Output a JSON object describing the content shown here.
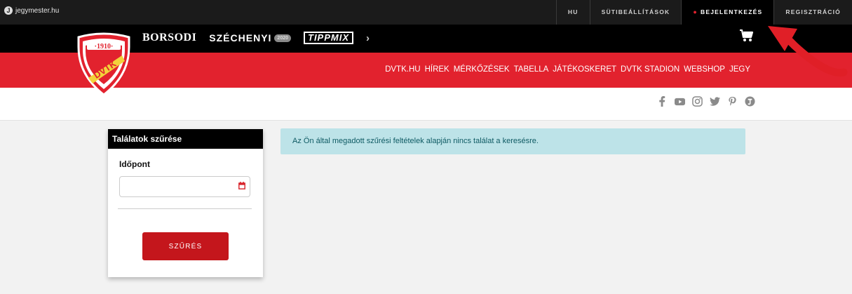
{
  "topbar": {
    "brand": "jegymester.hu",
    "links": {
      "lang": "HU",
      "cookies": "SÜTIBEÁLLÍTÁSOK",
      "login": "BEJELENTKEZÉS",
      "register": "REGISZTRÁCIÓ"
    }
  },
  "sponsors": {
    "borsodi": "BORSODI",
    "szechenyi": "SZÉCHENYI",
    "szechenyi_badge": "2020",
    "tippmix": "TIPPMIX",
    "next": "›"
  },
  "logo": {
    "year": "·1910·",
    "text": "DVTK"
  },
  "nav": {
    "items": [
      "DVTK.HU",
      "HÍREK",
      "MÉRKŐZÉSEK",
      "TABELLA",
      "JÁTÉKOSKERET",
      "DVTK STADION",
      "WEBSHOP",
      "JEGY"
    ]
  },
  "social": [
    "facebook-icon",
    "youtube-icon",
    "instagram-icon",
    "twitter-icon",
    "pinterest-icon",
    "jegymester-icon"
  ],
  "filter": {
    "title": "Találatok szűrése",
    "date_label": "Időpont",
    "date_value": "",
    "button": "SZŰRÉS"
  },
  "alert": {
    "message": "Az Ön által megadott szűrési feltételek alapján nincs találat a keresésre."
  },
  "colors": {
    "red": "#e2222e",
    "black": "#000000",
    "alert_bg": "#bde3e8",
    "alert_text": "#0e5a63"
  }
}
